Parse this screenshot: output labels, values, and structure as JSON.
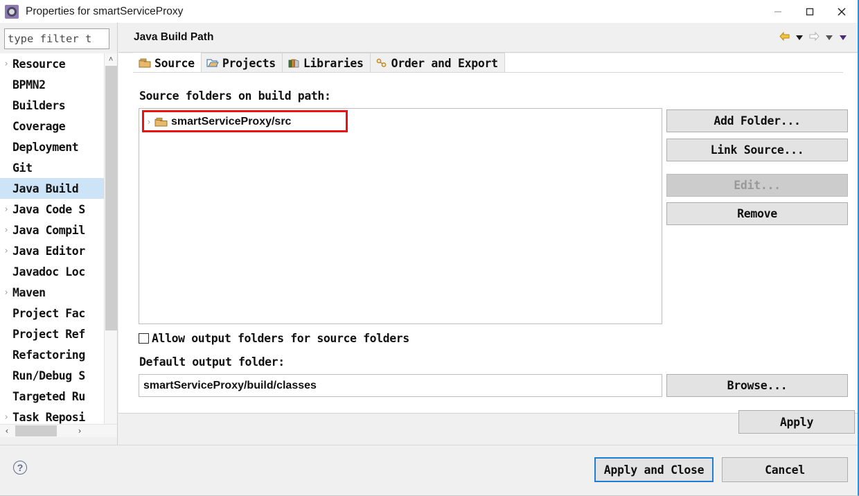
{
  "window": {
    "title": "Properties for smartServiceProxy",
    "icon": "properties-gear-icon",
    "minimize_label": "—",
    "maximize_label": "□",
    "close_label": "✕"
  },
  "sidebar": {
    "filter": {
      "placeholder": "type filter t",
      "value": "type filter t"
    },
    "items": [
      {
        "label": "Resource",
        "expandable": true,
        "selected": false
      },
      {
        "label": "BPMN2",
        "expandable": false,
        "selected": false
      },
      {
        "label": "Builders",
        "expandable": false,
        "selected": false
      },
      {
        "label": "Coverage",
        "expandable": false,
        "selected": false
      },
      {
        "label": "Deployment",
        "expandable": false,
        "selected": false
      },
      {
        "label": "Git",
        "expandable": false,
        "selected": false
      },
      {
        "label": "Java Build",
        "expandable": false,
        "selected": true
      },
      {
        "label": "Java Code S",
        "expandable": true,
        "selected": false
      },
      {
        "label": "Java Compil",
        "expandable": true,
        "selected": false
      },
      {
        "label": "Java Editor",
        "expandable": true,
        "selected": false
      },
      {
        "label": "Javadoc Loc",
        "expandable": false,
        "selected": false
      },
      {
        "label": "Maven",
        "expandable": true,
        "selected": false
      },
      {
        "label": "Project Fac",
        "expandable": false,
        "selected": false
      },
      {
        "label": "Project Ref",
        "expandable": false,
        "selected": false
      },
      {
        "label": "Refactoring",
        "expandable": false,
        "selected": false
      },
      {
        "label": "Run/Debug S",
        "expandable": false,
        "selected": false
      },
      {
        "label": "Targeted Ru",
        "expandable": false,
        "selected": false
      },
      {
        "label": "Task Reposi",
        "expandable": true,
        "selected": false
      }
    ],
    "scroll_up_glyph": "˄",
    "scroll_down_glyph": "˅",
    "scroll_left_glyph": "‹",
    "scroll_right_glyph": "›"
  },
  "page": {
    "title": "Java Build Path",
    "nav": {
      "back_icon": "back-arrow-icon",
      "back_menu_icon": "chevron-down-icon",
      "forward_icon": "forward-arrow-icon",
      "forward_menu_icon": "chevron-down-icon",
      "view_menu_icon": "chevron-down-icon"
    },
    "tabs": [
      {
        "label": "Source",
        "icon": "source-folder-icon",
        "active": true
      },
      {
        "label": "Projects",
        "icon": "open-folder-icon",
        "active": false
      },
      {
        "label": "Libraries",
        "icon": "library-books-icon",
        "active": false
      },
      {
        "label": "Order and Export",
        "icon": "order-export-icon",
        "active": false
      }
    ],
    "source_folders_label": "Source folders on build path:",
    "source_folders": [
      {
        "label": "smartServiceProxy/src",
        "icon": "source-folder-icon",
        "expandable": true,
        "highlighted": true
      }
    ],
    "buttons": [
      {
        "label": "Add Folder...",
        "enabled": true
      },
      {
        "label": "Link Source...",
        "enabled": true
      },
      {
        "label": "Edit...",
        "enabled": false
      },
      {
        "label": "Remove",
        "enabled": true
      }
    ],
    "allow_output_folders": {
      "label": "Allow output folders for source folders",
      "checked": false
    },
    "default_output_label": "Default output folder:",
    "default_output_value": "smartServiceProxy/build/classes",
    "browse_label": "Browse...",
    "apply_label": "Apply"
  },
  "footer": {
    "help_glyph": "?",
    "apply_and_close_label": "Apply and Close",
    "cancel_label": "Cancel"
  },
  "colors": {
    "selection_blue": "#cde3f7",
    "focus_blue": "#1d7fd4",
    "highlight_red": "#ee1111",
    "title_accent": "#8d79b5"
  }
}
